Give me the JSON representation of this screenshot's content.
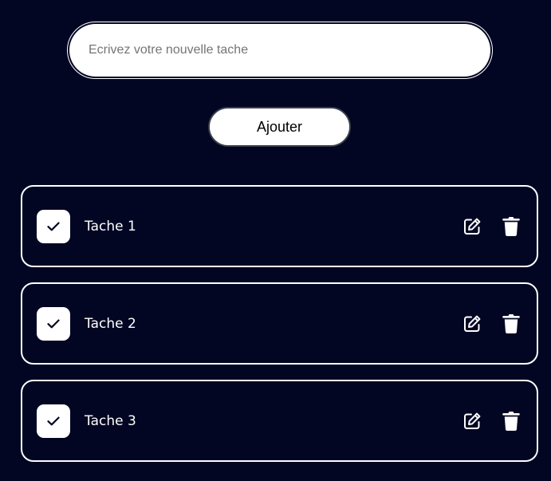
{
  "form": {
    "input_placeholder": "Ecrivez votre nouvelle tache",
    "input_value": "",
    "add_label": "Ajouter"
  },
  "tasks": [
    {
      "label": "Tache 1",
      "completed": true
    },
    {
      "label": "Tache 2",
      "completed": true
    },
    {
      "label": "Tache 3",
      "completed": true
    }
  ],
  "icons": {
    "check": "check-icon",
    "edit": "edit-icon",
    "delete": "trash-icon"
  },
  "colors": {
    "background": "#020623",
    "foreground": "#ffffff"
  }
}
